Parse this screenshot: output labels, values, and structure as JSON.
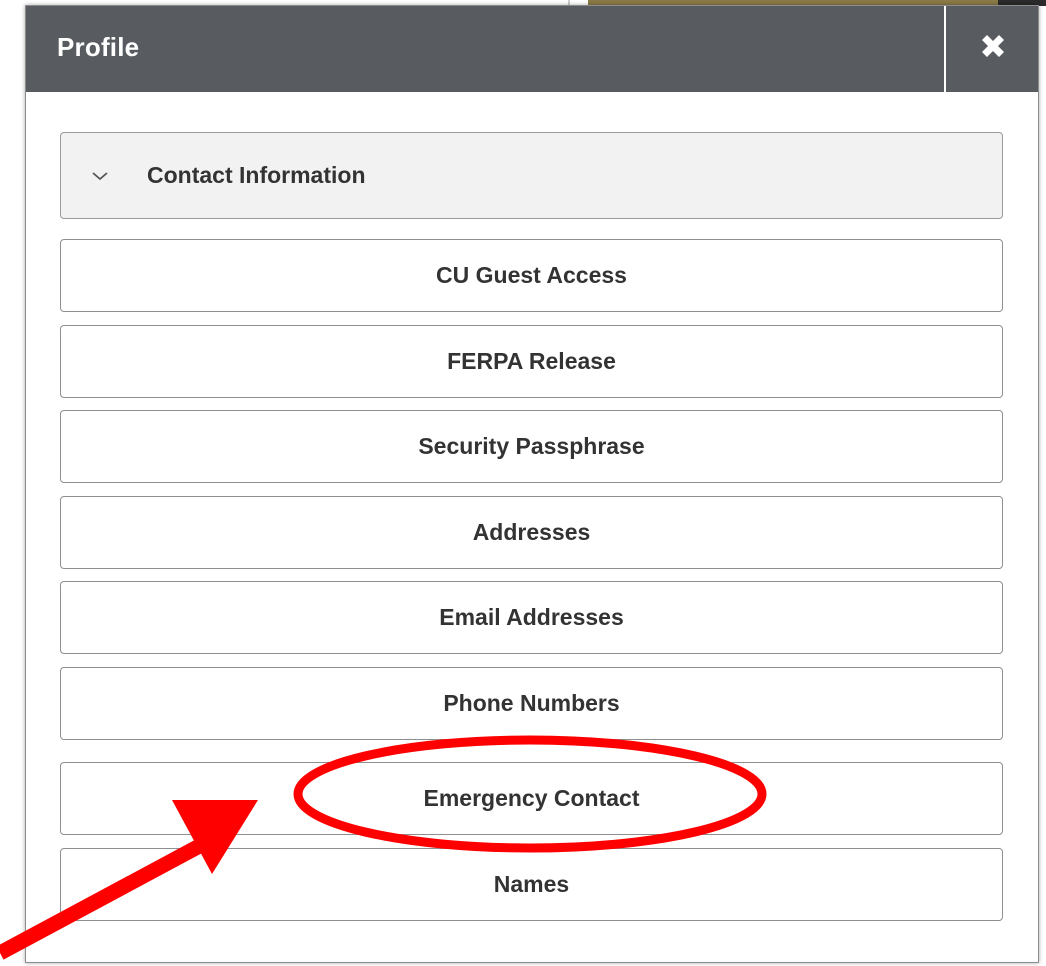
{
  "modal": {
    "title": "Profile",
    "close_icon": "close-x-icon"
  },
  "accordion": {
    "label": "Contact Information",
    "icon": "chevron-down-icon",
    "expanded": true
  },
  "menu_items": [
    {
      "label": "CU Guest Access"
    },
    {
      "label": "FERPA Release"
    },
    {
      "label": "Security Passphrase"
    },
    {
      "label": "Addresses"
    },
    {
      "label": "Email Addresses"
    },
    {
      "label": "Phone Numbers"
    },
    {
      "label": "Emergency Contact"
    },
    {
      "label": "Names"
    }
  ],
  "annotation": {
    "highlighted_item": "Emergency Contact",
    "color": "#ff0000"
  },
  "colors": {
    "header_bg": "#585c60",
    "header_text": "#ffffff",
    "accordion_bg": "#f2f2f2",
    "button_border": "#8f8f8f",
    "text": "#333333"
  }
}
